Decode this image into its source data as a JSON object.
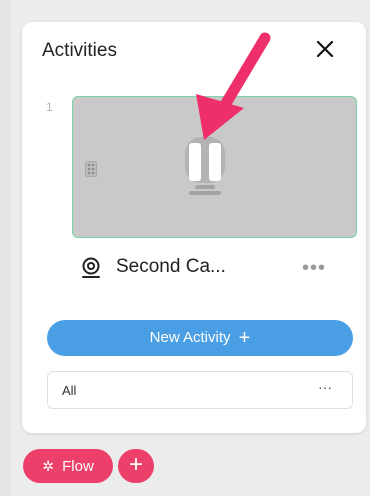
{
  "panel": {
    "title": "Activities",
    "close_icon": "close-icon"
  },
  "slot": {
    "index": "1",
    "preview_icon": "camera-icon",
    "overlay_icon": "pause-icon",
    "handle_icon": "drag-handle-icon"
  },
  "activity": {
    "icon": "camera-icon",
    "name": "Second Ca...",
    "more_label": "•••"
  },
  "new_activity": {
    "label": "New Activity",
    "plus": "+"
  },
  "filter": {
    "value": "All",
    "more_label": "···"
  },
  "bottom": {
    "flow_icon": "✲",
    "flow_label": "Flow",
    "add_label": "+"
  },
  "colors": {
    "accent_blue": "#4a9ee3",
    "accent_pink": "#ec3f6a",
    "card_border": "#7bd3a6",
    "annotation_arrow": "#ee2f6a"
  }
}
